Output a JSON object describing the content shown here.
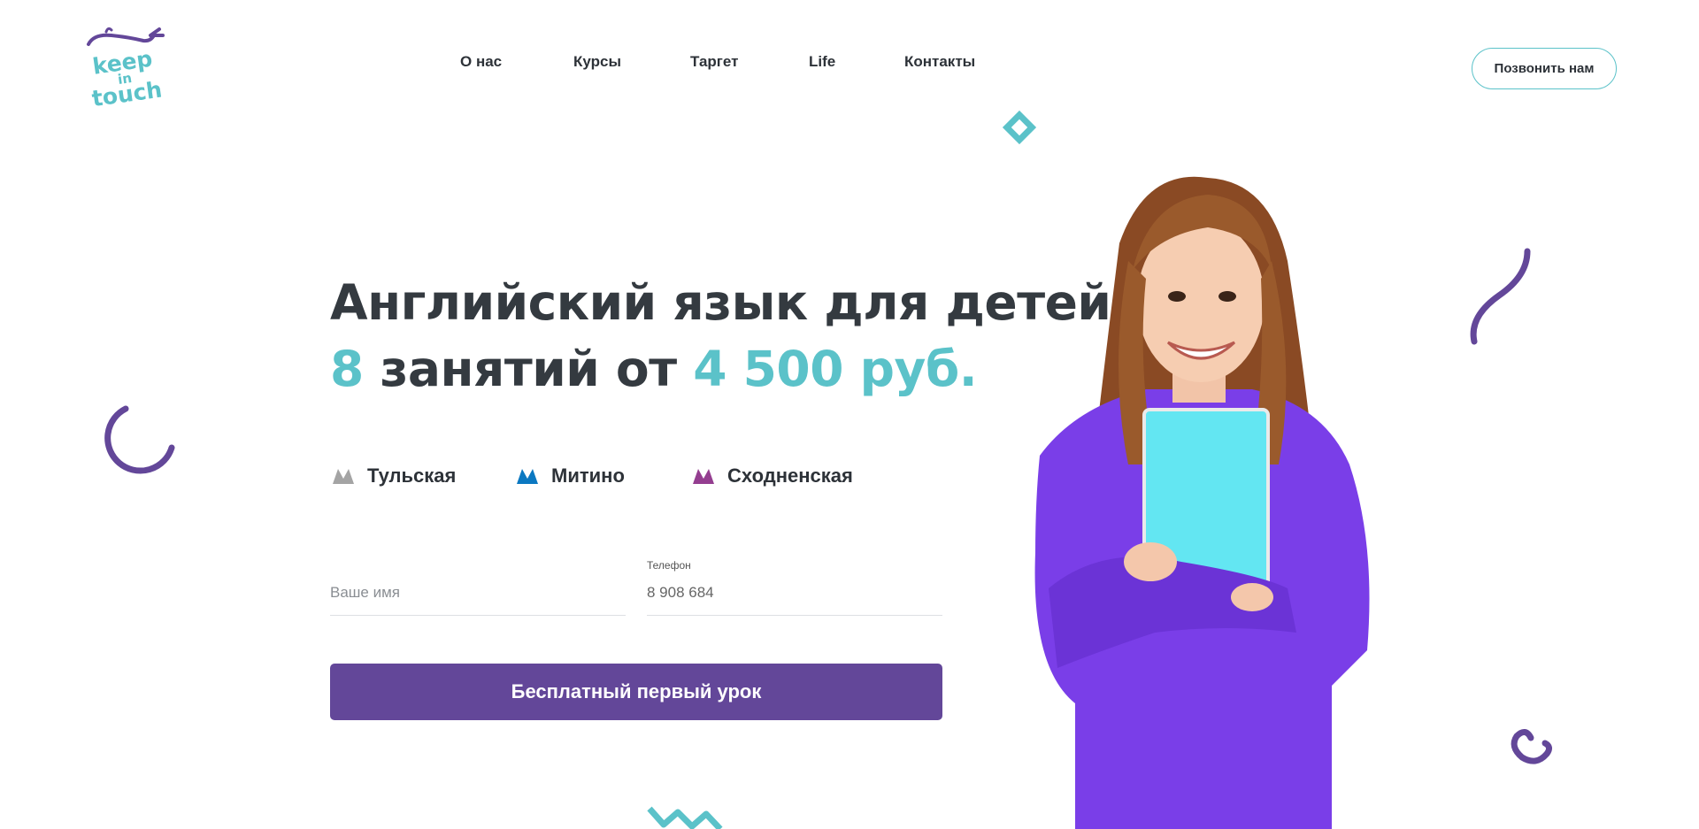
{
  "logo": {
    "line1": "keep",
    "line2": "in",
    "line3": "touch"
  },
  "nav": {
    "items": [
      {
        "label": "О нас"
      },
      {
        "label": "Курсы"
      },
      {
        "label": "Таргет"
      },
      {
        "label": "Life"
      },
      {
        "label": "Контакты"
      }
    ]
  },
  "header": {
    "call_label": "Позвонить нам"
  },
  "hero": {
    "title_line1": "Английский язык для детей",
    "lessons_count": "8",
    "lessons_text": " занятий от ",
    "price": "4 500 руб."
  },
  "metro": [
    {
      "label": "Тульская",
      "color": "#a4a4a4"
    },
    {
      "label": "Митино",
      "color": "#0b78c1"
    },
    {
      "label": "Сходненская",
      "color": "#943e90"
    }
  ],
  "form": {
    "name_placeholder": "Ваше имя",
    "phone_label": "Телефон",
    "phone_value": "8 908 684",
    "submit_label": "Бесплатный первый урок"
  },
  "colors": {
    "accent": "#5bc2c9",
    "primary": "#634799",
    "text": "#343a40",
    "sweater": "#7a3ee8",
    "book": "#63e6f2"
  }
}
